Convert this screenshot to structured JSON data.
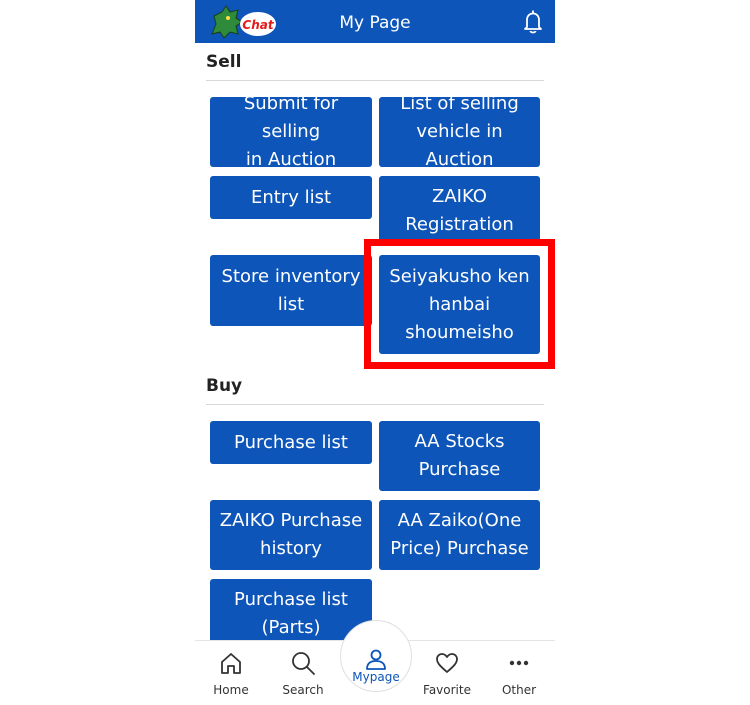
{
  "header": {
    "title": "My Page",
    "logo_text": "Chat"
  },
  "sell": {
    "title": "Sell",
    "buttons": [
      "Submit for selling\nin Auction",
      "List of selling\nvehicle in Auction",
      "Entry list",
      "ZAIKO\nRegistration",
      "Store inventory\nlist",
      "Seiyakusho ken\nhanbai\nshoumeisho"
    ]
  },
  "buy": {
    "title": "Buy",
    "buttons": [
      "Purchase list",
      "AA Stocks\nPurchase",
      "ZAIKO Purchase\nhistory",
      "AA Zaiko(One\nPrice) Purchase",
      "Purchase list\n(Parts)"
    ]
  },
  "nav": {
    "home": "Home",
    "search": "Search",
    "mypage": "Mypage",
    "favorite": "Favorite",
    "other": "Other"
  },
  "colors": {
    "primary": "#0d55b8",
    "highlight": "#ff0000"
  }
}
